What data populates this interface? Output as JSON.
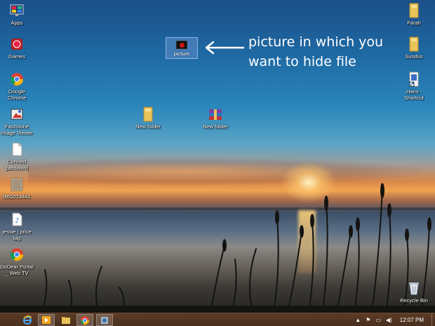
{
  "desktop": {
    "left_icons": [
      {
        "label": "Apps",
        "icon": "apps-monitor-icon"
      },
      {
        "label": "Games",
        "icon": "games-icon"
      },
      {
        "label": "Google\nChrome",
        "icon": "chrome-icon"
      },
      {
        "label": "FastStone\nImage Viewer",
        "icon": "faststone-icon"
      },
      {
        "label": "Connect\npassword",
        "icon": "text-file-icon"
      },
      {
        "label": "IMG013441",
        "icon": "image-file-icon"
      },
      {
        "label": "jessie j price\ntag",
        "icon": "audio-file-icon"
      },
      {
        "label": "DoDear Portal\n_ Web TV",
        "icon": "chrome-icon"
      }
    ],
    "right_icons": [
      {
        "label": "Farah",
        "icon": "folder-icon"
      },
      {
        "label": "Sundus",
        "icon": "folder-icon"
      },
      {
        "label": "Hans -\nShortcut",
        "icon": "shortcut-icon"
      },
      {
        "label": "Recycle Bin",
        "icon": "recycle-bin-icon"
      }
    ],
    "middle_icons": [
      {
        "label": "New folder",
        "icon": "folder-icon"
      },
      {
        "label": "New folder",
        "icon": "winrar-archive-icon"
      }
    ],
    "selected_icon": {
      "label": "picture",
      "icon": "picture-file-icon"
    },
    "annotation": "picture in which you\nwant to hide file"
  },
  "taskbar": {
    "buttons": [
      "ie-icon",
      "media-player-icon",
      "file-explorer-icon",
      "chrome-icon",
      "app-icon"
    ],
    "tray_icons": [
      "tray-chevron-icon",
      "action-center-flag-icon",
      "network-icon",
      "volume-icon"
    ],
    "clock": "12:07 PM"
  }
}
